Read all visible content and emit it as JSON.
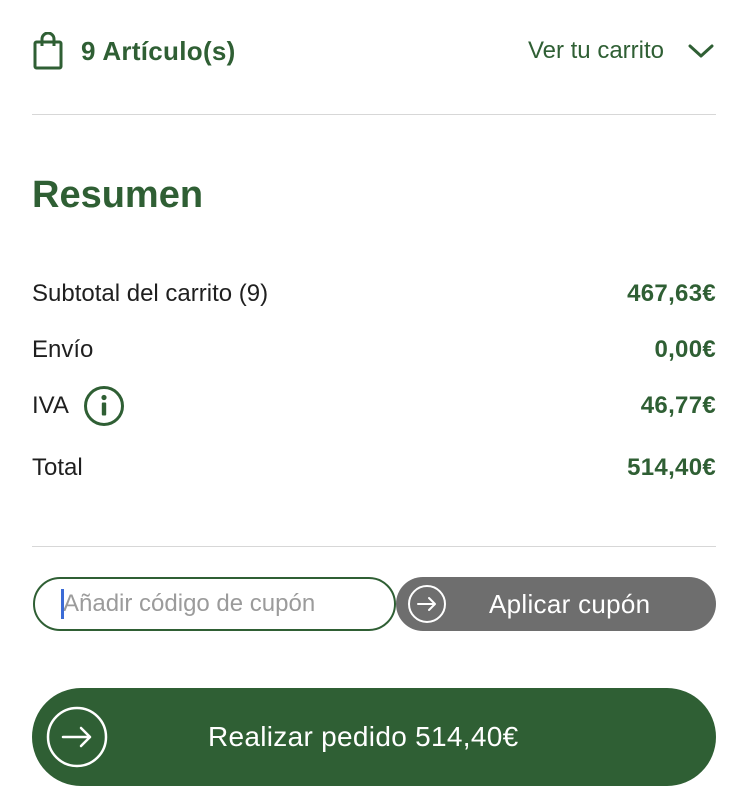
{
  "cart_header": {
    "item_count_label": "9 Artículo(s)",
    "view_cart_label": "Ver tu carrito",
    "bag_icon": "shopping-bag-icon",
    "chevron_icon": "chevron-down-icon"
  },
  "summary": {
    "title": "Resumen",
    "rows": [
      {
        "label": "Subtotal del carrito (9)",
        "value": "467,63€"
      },
      {
        "label": "Envío",
        "value": "0,00€"
      },
      {
        "label": "IVA",
        "value": "46,77€",
        "info_icon": "info-icon"
      },
      {
        "label": "Total",
        "value": "514,40€"
      }
    ]
  },
  "coupon": {
    "placeholder": "Añadir código de cupón",
    "value": "",
    "apply_label": "Aplicar cupón",
    "apply_icon": "arrow-right-circle-icon"
  },
  "checkout": {
    "label": "Realizar pedido 514,40€",
    "icon": "arrow-right-circle-icon"
  },
  "colors": {
    "brand_green": "#2f5f34",
    "coupon_button_gray": "#6e6e6e",
    "divider": "#d7d7d7",
    "text": "#1f1f1f"
  }
}
